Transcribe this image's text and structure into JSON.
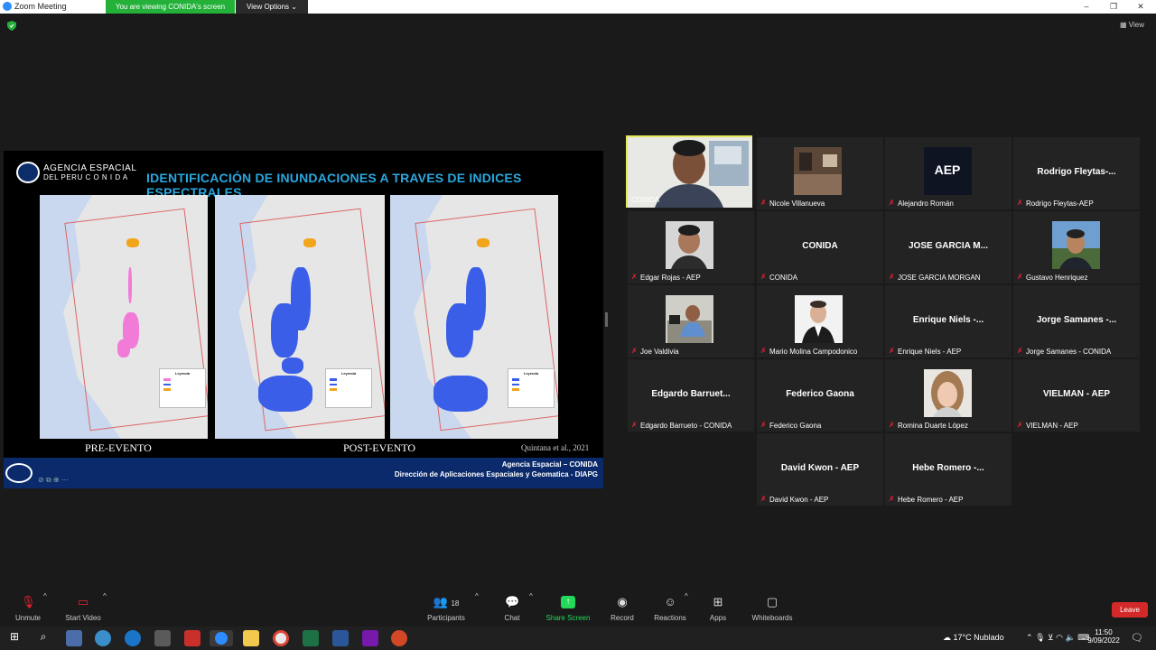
{
  "titlebar": {
    "app_title": "Zoom Meeting",
    "viewing_banner": "You are viewing CONIDA's screen",
    "view_options": "View Options ⌄",
    "minimize": "–",
    "restore": "❐",
    "close": "✕"
  },
  "top": {
    "view_label": "View"
  },
  "slide": {
    "org_line1": "AGENCIA ESPACIAL",
    "org_line2": "DEL PERU  C O N I D A",
    "title": "IDENTIFICACIÓN DE INUNDACIONES  A TRAVES DE INDICES ESPECTRALES",
    "pre_label": "PRE-EVENTO",
    "post_label": "POST-EVENTO",
    "citation": "Quintana et al., 2021",
    "footer_line1": "Agencia Espacial – CONIDA",
    "footer_line2": "Dirección de Aplicaciones Espaciales y Geomatica - DIAPG",
    "legend_title": "Leyenda"
  },
  "participants_tiles": [
    {
      "name": "CONIDA",
      "big": "",
      "photo": true,
      "muted": false,
      "active": true
    },
    {
      "name": "Nicole Villanueva",
      "big": "",
      "photo": true,
      "muted": true
    },
    {
      "name": "Alejandro Román",
      "big": "",
      "photo": true,
      "muted": true
    },
    {
      "name": "Rodrigo Fleytas-AEP",
      "big": "Rodrigo  Fleytas-...",
      "photo": false,
      "muted": true
    },
    {
      "name": "Edgar Rojas - AEP",
      "big": "",
      "photo": true,
      "muted": true
    },
    {
      "name": "CONIDA",
      "big": "CONIDA",
      "photo": false,
      "muted": true
    },
    {
      "name": "JOSE GARCIA MORGAN",
      "big": "JOSE GARCIA M...",
      "photo": false,
      "muted": true
    },
    {
      "name": "Gustavo Henriquez",
      "big": "",
      "photo": true,
      "muted": true
    },
    {
      "name": "Joe Valdivia",
      "big": "",
      "photo": true,
      "muted": true
    },
    {
      "name": "Mario Molina Campodonico",
      "big": "",
      "photo": true,
      "muted": true
    },
    {
      "name": "Enrique Niels - AEP",
      "big": "Enrique  Niels  -...",
      "photo": false,
      "muted": true
    },
    {
      "name": "Jorge Samanes - CONIDA",
      "big": "Jorge  Samanes  -...",
      "photo": false,
      "muted": true
    },
    {
      "name": "Edgardo Barrueto - CONIDA",
      "big": "Edgardo  Barruet...",
      "photo": false,
      "muted": true
    },
    {
      "name": "Federico Gaona",
      "big": "Federico Gaona",
      "photo": false,
      "muted": true
    },
    {
      "name": "Romina Duarte López",
      "big": "",
      "photo": true,
      "muted": true
    },
    {
      "name": "VIELMAN - AEP",
      "big": "VIELMAN - AEP",
      "photo": false,
      "muted": true
    },
    {
      "name": "David Kwon - AEP",
      "big": "David Kwon - AEP",
      "photo": false,
      "muted": true
    },
    {
      "name": "Hebe Romero - AEP",
      "big": "Hebe  Romero  -...",
      "photo": false,
      "muted": true
    }
  ],
  "controls": {
    "unmute": "Unmute",
    "start_video": "Start Video",
    "participants": "Participants",
    "participants_count": "18",
    "chat": "Chat",
    "share_screen": "Share Screen",
    "record": "Record",
    "reactions": "Reactions",
    "apps": "Apps",
    "whiteboards": "Whiteboards",
    "leave": "Leave"
  },
  "tray": {
    "weather": "17°C  Nublado",
    "time": "11:50",
    "date": "9/09/2022"
  },
  "colors": {
    "viewing_green": "#23b13a",
    "share_green": "#23d959",
    "leave_red": "#d32929",
    "active_border": "#e5e85a",
    "flood_blue": "#3b5ee8",
    "flood_pink": "#f27bd8"
  }
}
